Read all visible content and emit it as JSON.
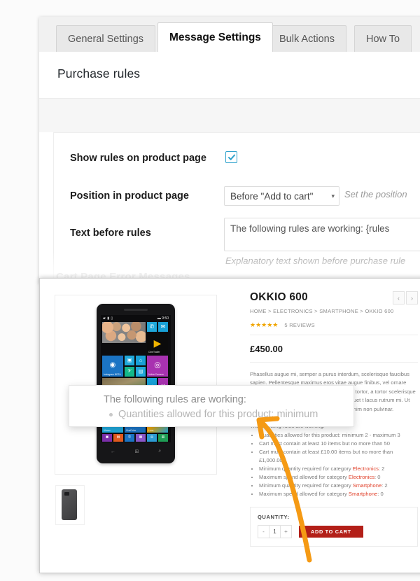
{
  "tabs": [
    {
      "label": "General Settings",
      "active": false
    },
    {
      "label": "Message Settings",
      "active": true
    },
    {
      "label": "Bulk Actions",
      "active": false
    },
    {
      "label": "How To",
      "active": false
    }
  ],
  "settings": {
    "section_title": "Purchase rules",
    "faded_section_title": "Cart Page Error Messages",
    "fields": {
      "show_rules": {
        "label": "Show rules on product page",
        "checked": true,
        "check_glyph": "check-icon"
      },
      "position": {
        "label": "Position in product page",
        "value": "Before \"Add to cart\"",
        "caret": "▾",
        "hint": "Set the position"
      },
      "text_before_rules": {
        "label": "Text before rules",
        "value": "The following rules are working: {rules",
        "hint": "Explanatory text shown before purchase rule"
      }
    },
    "accent_color": "#2ea2cc"
  },
  "preview": {
    "product": {
      "title": "OKKIO 600",
      "breadcrumb": "HOME > ELECTRONICS > SMARTPHONE > OKKIO 600",
      "stars": "★★★★★",
      "reviews": "5 REVIEWS",
      "price": "£450.00",
      "price_currency": "£",
      "prev_arrow": "‹",
      "next_arrow": "›",
      "description": "Phasellus augue mi, semper a purus interdum, scelerisque faucibus sapien. Pellentesque maximus eros vitae augue finibus, vel ornare risus luctus. Pellentesque elementum metus tortor, a tortor scelerisque bus et magnis dis n laoreet diam ut quis aliquet t lacus rutrum mi. Ut dapibus faucibus rhoncus, sed aliquet sed enim non pulvinar.",
      "rules_intro": "The following rules are working:",
      "rules": [
        {
          "text": "Quantities allowed for this product: minimum 2 - maximum 3"
        },
        {
          "text": "Cart must contain at least 10 items but no more than 50"
        },
        {
          "text": "Cart must contain at least £10.00 items but no more than £1,000.00"
        },
        {
          "text": "Minimum quantity required for category ",
          "category": "Electronics",
          "suffix": ": 2"
        },
        {
          "text": "Maximum spend allowed for category ",
          "category": "Electronics",
          "suffix": ": 0"
        },
        {
          "text": "Minimum quantity required for category ",
          "category": "Smartphone",
          "suffix": ": 2"
        },
        {
          "text": "Maximum spend allowed for category ",
          "category": "Smartphone",
          "suffix": ": 0"
        }
      ],
      "category_color": "#e0402a",
      "quantity_label": "QUANTITY:",
      "qty_minus": "-",
      "qty_value": "1",
      "qty_plus": "+",
      "add_to_cart": "ADD TO CART",
      "add_to_cart_color": "#b31f18"
    },
    "phone": {
      "status_left": "▰ ▮ ▯",
      "status_right": "▬ 9:50",
      "tiles": [
        {
          "name": "people-tile",
          "label": ""
        },
        {
          "name": "phone-tile",
          "label": ""
        },
        {
          "name": "messaging-tile",
          "label": ""
        },
        {
          "name": "instagram-tile",
          "label": "Instagram BETA"
        },
        {
          "name": "cinetrailer-tile",
          "label": "CineTrailer"
        },
        {
          "name": "vine-tile",
          "label": ""
        },
        {
          "name": "nokia-camera-tile",
          "label": "Nokia Camera"
        },
        {
          "name": "vimeo-tile",
          "label": "Vimeo"
        },
        {
          "name": "onedrive-tile",
          "label": "OneDrive"
        },
        {
          "name": "visual-tile",
          "label": "Lens"
        }
      ],
      "nav_back": "←",
      "nav_home": "⊞",
      "nav_search": "⌕"
    }
  },
  "callout": {
    "line1": "The following rules are working:",
    "line2": "Quantities allowed for this product: minimum",
    "bullet": "•"
  },
  "annotation": {
    "arrow_color": "#f59a14",
    "name": "orange-arrow"
  }
}
